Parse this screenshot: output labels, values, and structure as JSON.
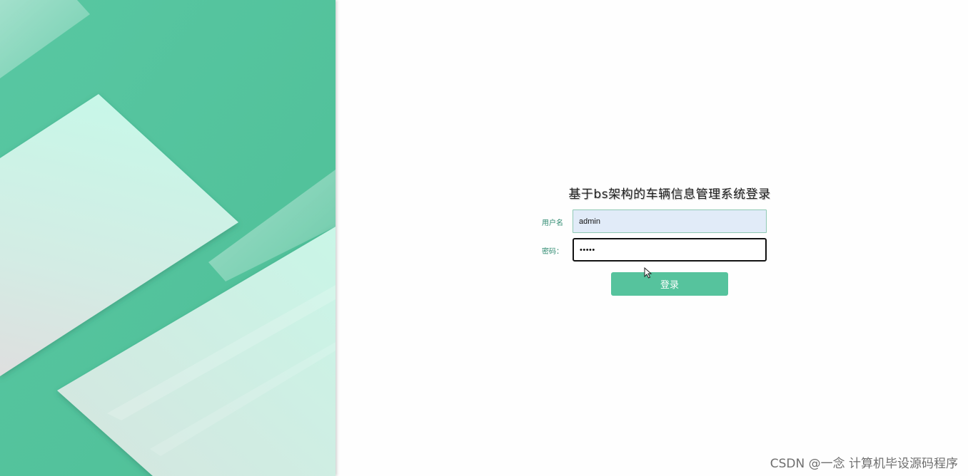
{
  "login": {
    "title": "基于bs架构的车辆信息管理系统登录",
    "username_label": "用户名",
    "username_value": "admin",
    "password_label": "密码：",
    "password_value": "*****",
    "submit_label": "登录"
  },
  "watermark": "CSDN @一念 计算机毕设源码程序",
  "colors": {
    "accent": "#56c39d",
    "panel_green": "#52c39c",
    "panel_light": "#c7f5e6",
    "input_fill": "#e1ebf8"
  },
  "icons": {
    "cursor": "mouse-pointer-icon"
  }
}
